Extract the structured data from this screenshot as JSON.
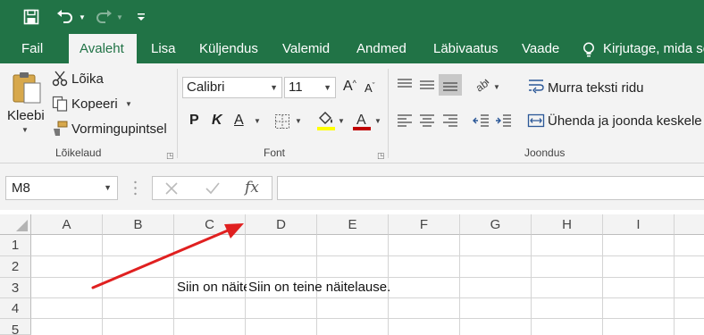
{
  "qat": {
    "save_icon": "save-icon",
    "undo_icon": "undo-icon",
    "redo_icon": "redo-icon",
    "customize_icon": "customize-qat-icon"
  },
  "tabs": [
    {
      "label": "Fail"
    },
    {
      "label": "Avaleht"
    },
    {
      "label": "Lisa"
    },
    {
      "label": "Küljendus"
    },
    {
      "label": "Valemid"
    },
    {
      "label": "Andmed"
    },
    {
      "label": "Läbivaatus"
    },
    {
      "label": "Vaade"
    }
  ],
  "tell_me": "Kirjutage, mida se",
  "clipboard": {
    "paste": "Kleebi",
    "cut": "Lõika",
    "copy": "Kopeeri",
    "format_painter": "Vormingupintsel",
    "label": "Lõikelaud"
  },
  "font": {
    "name": "Calibri",
    "size": "11",
    "bold": "P",
    "italic": "K",
    "underline": "A",
    "label": "Font",
    "highlight_color": "#ffff00",
    "font_color": "#c00000"
  },
  "alignment": {
    "wrap_text": "Murra teksti ridu",
    "merge_center": "Ühenda ja joonda keskele",
    "label": "Joondus"
  },
  "formula_bar": {
    "name_box": "M8",
    "fx": "fx",
    "value": ""
  },
  "grid": {
    "columns": [
      "A",
      "B",
      "C",
      "D",
      "E",
      "F",
      "G",
      "H",
      "I"
    ],
    "rows": [
      "1",
      "2",
      "3",
      "4",
      "5"
    ],
    "cell_C3": "Siin on näitelause.",
    "cell_D3": "Siin on teine näitelause."
  },
  "annotation": {
    "color": "#e02020"
  },
  "colors": {
    "brand": "#217346"
  }
}
